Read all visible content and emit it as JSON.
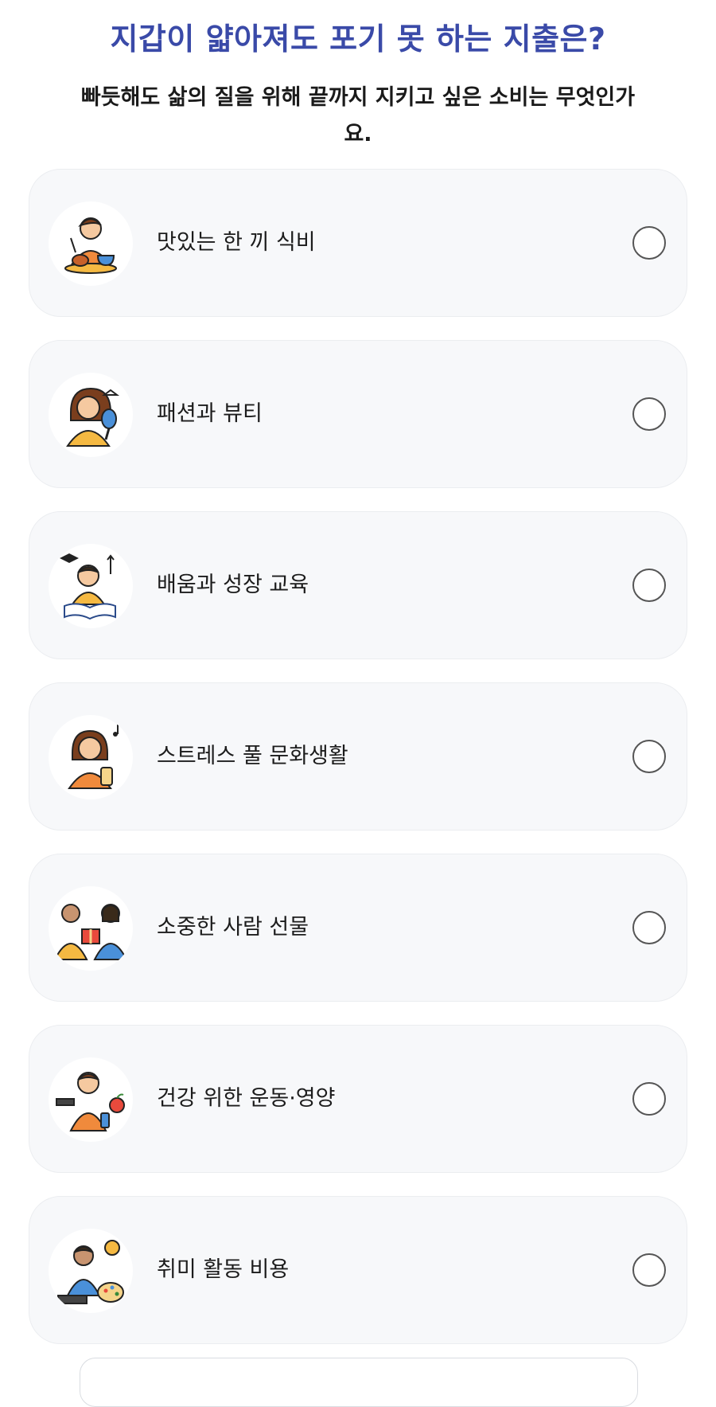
{
  "header": {
    "title": "지갑이 얇아져도 포기 못 하는 지출은?",
    "subtitle": "빠듯해도 삶의 질을 위해 끝까지 지키고 싶은 소비는 무엇인가요."
  },
  "options": [
    {
      "label": "맛있는 한 끼 식비",
      "icon": "eating-person-icon",
      "selected": false
    },
    {
      "label": "패션과 뷰티",
      "icon": "makeup-person-icon",
      "selected": false
    },
    {
      "label": "배움과 성장 교육",
      "icon": "studying-person-icon",
      "selected": false
    },
    {
      "label": "스트레스 풀 문화생활",
      "icon": "culture-person-icon",
      "selected": false
    },
    {
      "label": "소중한 사람 선물",
      "icon": "gift-exchange-icon",
      "selected": false
    },
    {
      "label": "건강 위한 운동·영양",
      "icon": "fitness-person-icon",
      "selected": false
    },
    {
      "label": "취미 활동 비용",
      "icon": "hobby-person-icon",
      "selected": false
    }
  ],
  "colors": {
    "title": "#3a4aa8",
    "card_bg": "#f7f8fa",
    "card_border": "#ebedf0",
    "radio_border": "#555555",
    "accent_orange": "#f08a3c"
  }
}
